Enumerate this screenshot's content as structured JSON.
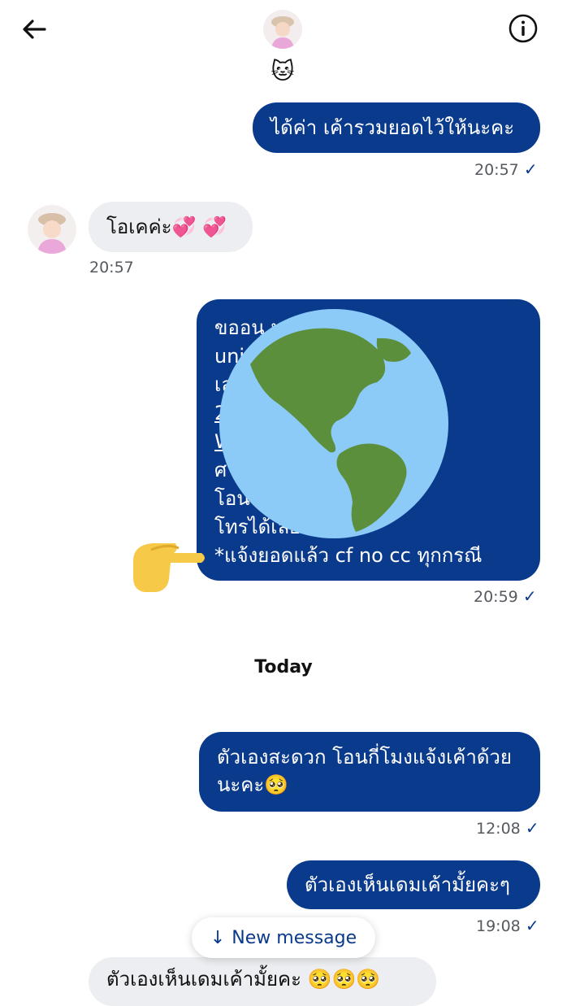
{
  "header": {
    "status_emoji": "🐱"
  },
  "messages": [
    {
      "text": "ได้ค่า เค้ารวมยอดไว้ให้นะคะ",
      "time": "20:57",
      "check": "✓"
    },
    {
      "text": "โอเคค่ะ💞 💞",
      "time": "20:57"
    },
    {
      "lines": [
        "ขออนุ           นะคะ ม้าค",
        "uni",
        "เล",
        "2                                   ย)",
        "W                                   7",
        "ศ",
        "โอน                         อที่อยู่เบอร์",
        "โทรได้เลย",
        "*แจ้งยอดแล้ว cf no cc ทุกกรณี"
      ],
      "time": "20:59",
      "check": "✓"
    },
    {
      "text_line1": "ตัวเองสะดวก โอนกี่โมงแจ้งเค้าด้วย",
      "text_line2": "นะคะ🥺",
      "time": "12:08",
      "check": "✓"
    },
    {
      "text": "ตัวเองเห็นเดมเค้ามั้ยคะๆ",
      "time": "19:08",
      "check": "✓"
    },
    {
      "text": "ตัวเองเห็นเดมเค้ามั้ยคะ 🥺🥺🥺"
    }
  ],
  "divider": {
    "today_label": "Today"
  },
  "new_message": {
    "arrow": "↓",
    "label": "New message"
  },
  "colors": {
    "outgoing_bubble": "#0a3a8c",
    "incoming_bubble": "#eceef1",
    "accent": "#0a3a8c"
  },
  "icons": {
    "back": "back-arrow-icon",
    "info": "info-icon",
    "overlay_globe": "globe-icon",
    "overlay_pointer": "pointing-hand-icon"
  }
}
